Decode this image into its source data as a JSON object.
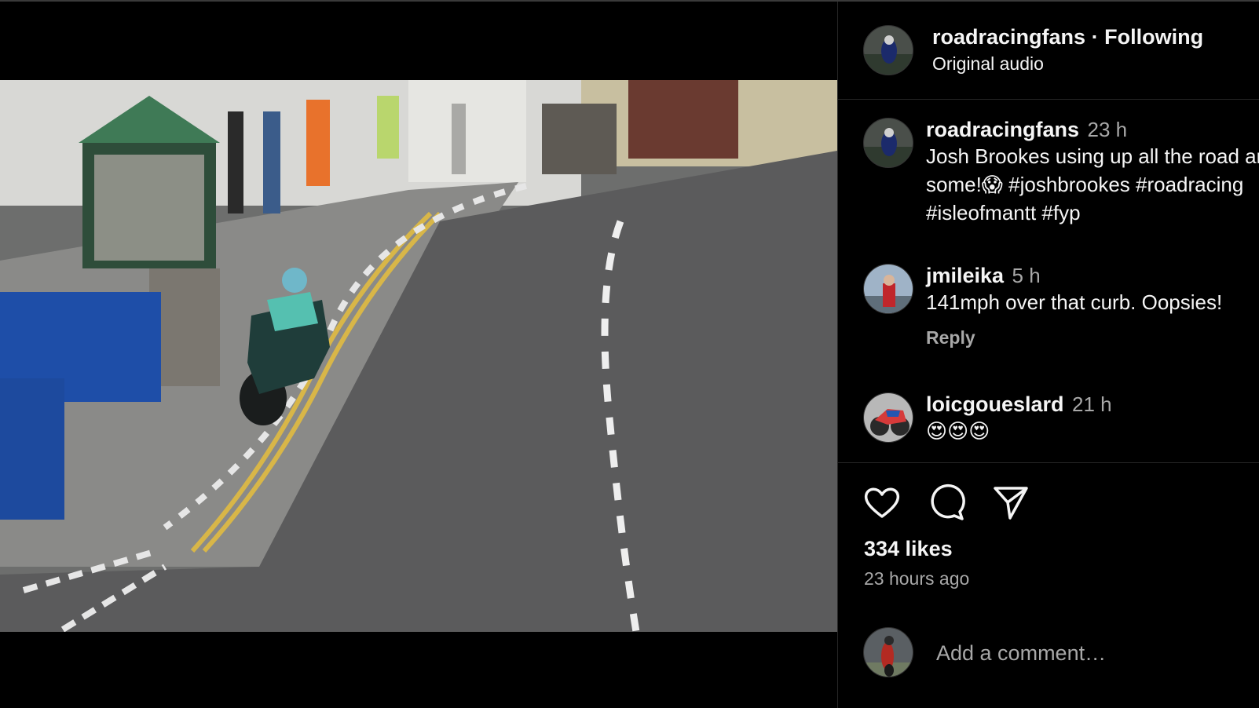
{
  "header": {
    "username": "roadracingfans",
    "separator": "·",
    "follow_status": "Following",
    "audio": "Original audio"
  },
  "video": {
    "mute_icon": "speaker-icon"
  },
  "caption": {
    "username": "roadracingfans",
    "time": "23 h",
    "lines": [
      "Josh Brookes using up all the road and",
      "some!😱 #joshbrookes #roadracing",
      "#isleofmantt #fyp"
    ]
  },
  "comments": [
    {
      "username": "jmileika",
      "time": "5 h",
      "text": "141mph over that curb. Oopsies!",
      "reply": "Reply"
    },
    {
      "username": "loicgoueslard",
      "time": "21 h",
      "text": "😍😍😍"
    }
  ],
  "actions": {
    "like_icon": "heart-icon",
    "comment_icon": "comment-icon",
    "share_icon": "share-icon"
  },
  "likes": "334 likes",
  "posted": "23 hours ago",
  "add_comment": {
    "placeholder": "Add a comment…"
  }
}
